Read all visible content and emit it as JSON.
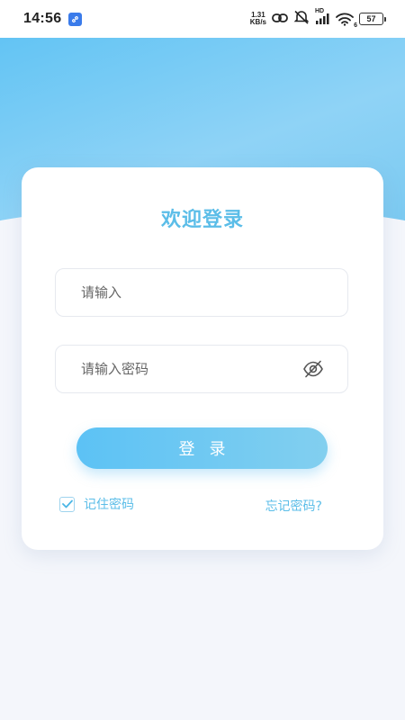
{
  "status_bar": {
    "time": "14:56",
    "net_speed_value": "1.31",
    "net_speed_unit": "KB/s",
    "hd_label": "HD",
    "signal_label": "6",
    "battery_level": "57"
  },
  "login": {
    "title": "欢迎登录",
    "username_placeholder": "请输入",
    "password_placeholder": "请输入密码",
    "login_button": "登录",
    "remember_label": "记住密码",
    "remember_checked": true,
    "forgot_label": "忘记密码?"
  },
  "colors": {
    "accent": "#5bbde8",
    "header_gradient_start": "#63c4f4",
    "header_gradient_end": "#8fd3f6",
    "background": "#f4f6fb"
  },
  "icons": {
    "password_toggle": "eye-off-icon",
    "checkbox": "checkmark-icon",
    "app_badge": "link-icon"
  }
}
